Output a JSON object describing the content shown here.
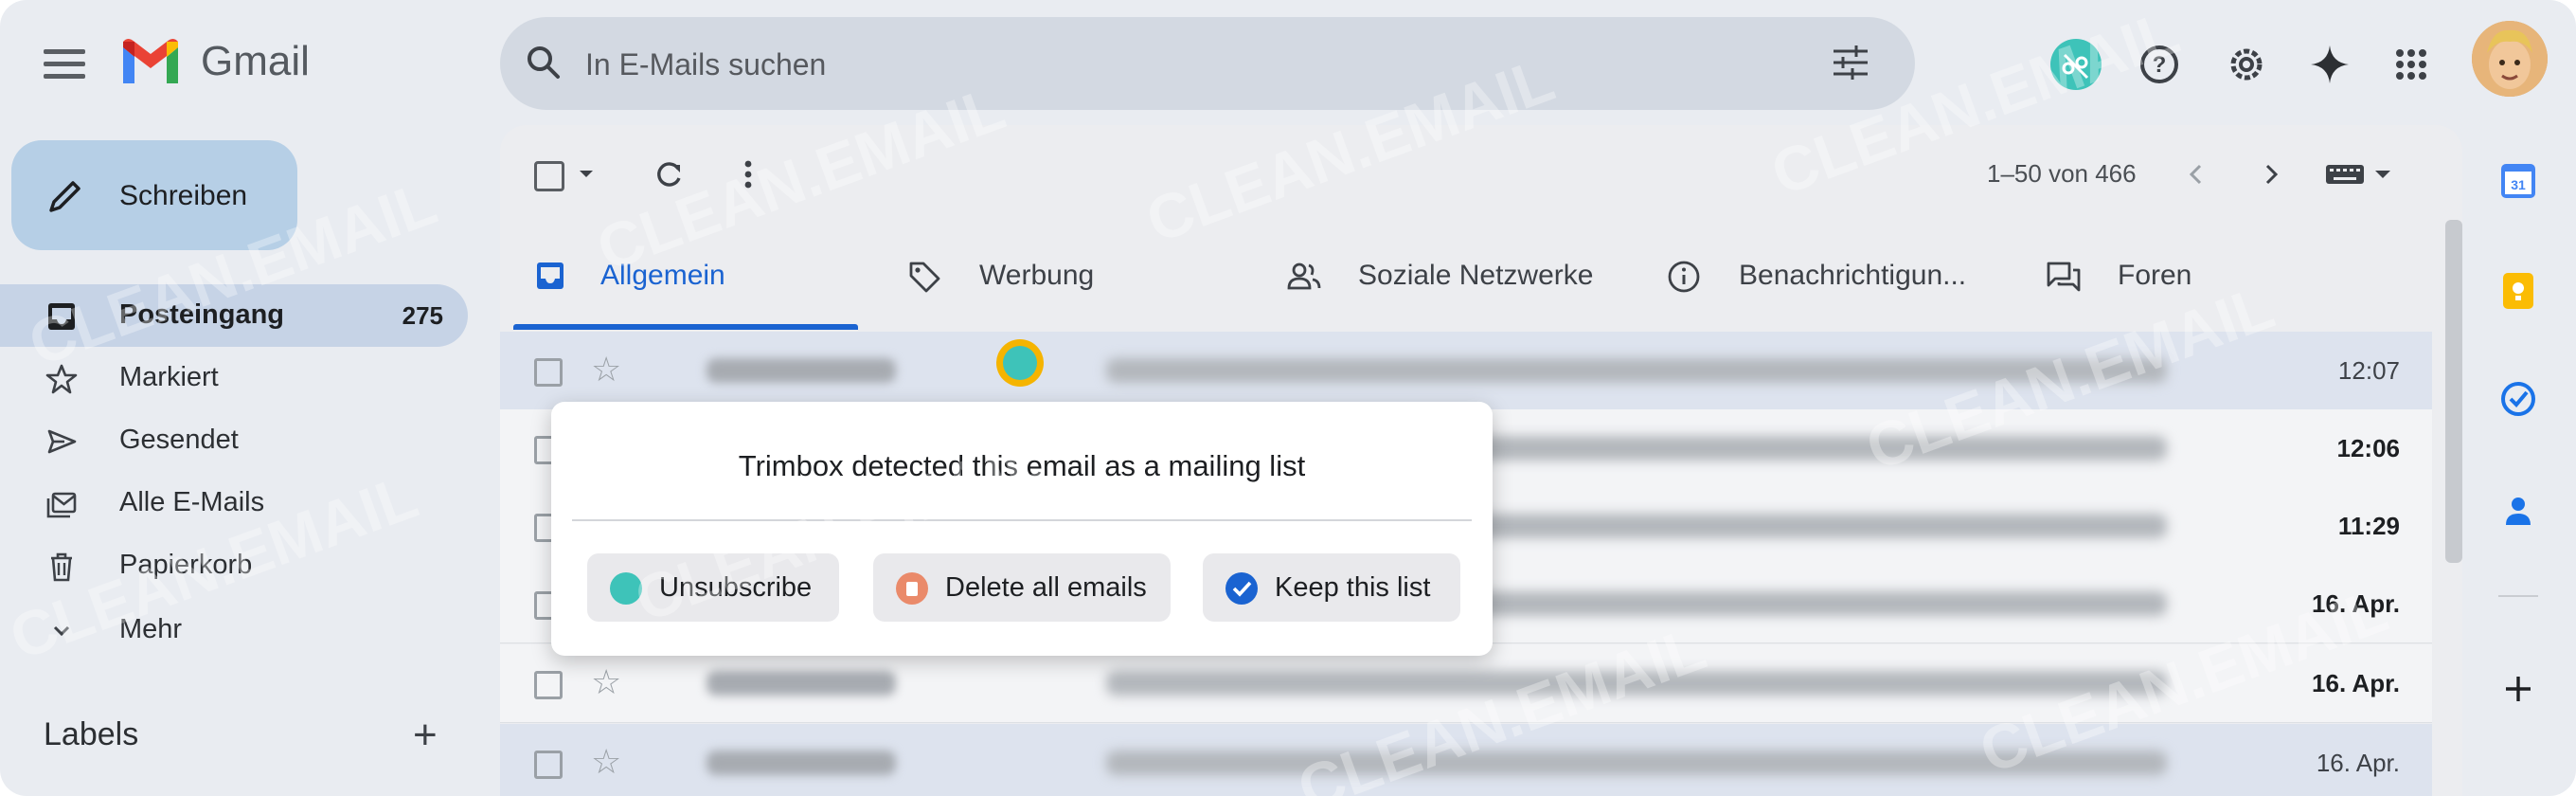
{
  "app": {
    "logo_text": "Gmail",
    "brand_colors": {
      "accent": "#1a63d1",
      "trimbox": "#3ec3b9",
      "trimbox_ring": "#f5b400"
    }
  },
  "search": {
    "placeholder": "In E-Mails suchen"
  },
  "compose": {
    "label": "Schreiben"
  },
  "nav": [
    {
      "label": "Posteingang",
      "count": "275",
      "icon": "inbox-icon",
      "active": true
    },
    {
      "label": "Markiert",
      "icon": "star-icon"
    },
    {
      "label": "Gesendet",
      "icon": "send-icon"
    },
    {
      "label": "Alle E-Mails",
      "icon": "all-mail-icon"
    },
    {
      "label": "Papierkorb",
      "icon": "trash-icon"
    },
    {
      "label": "Mehr",
      "icon": "chevron-down-icon"
    }
  ],
  "labels": {
    "heading": "Labels",
    "add_symbol": "+"
  },
  "toolbar": {
    "pagination": "1–50 von 466"
  },
  "tabs": [
    {
      "label": "Allgemein",
      "icon": "inbox-icon",
      "active": true
    },
    {
      "label": "Werbung",
      "icon": "tag-icon"
    },
    {
      "label": "Soziale Netzwerke",
      "icon": "people-icon"
    },
    {
      "label": "Benachrichtigun...",
      "icon": "info-icon"
    },
    {
      "label": "Foren",
      "icon": "forum-icon"
    }
  ],
  "emails": [
    {
      "time": "12:07",
      "bold": false
    },
    {
      "time": "12:06",
      "bold": true
    },
    {
      "time": "11:29",
      "bold": true
    },
    {
      "time": "16. Apr.",
      "bold": true
    },
    {
      "time": "16. Apr.",
      "bold": true
    },
    {
      "time": "16. Apr.",
      "bold": false
    }
  ],
  "trimbox_popup": {
    "message": "Trimbox detected this email as a mailing list",
    "buttons": [
      {
        "label": "Unsubscribe",
        "icon": "trimbox-icon"
      },
      {
        "label": "Delete all emails",
        "icon": "delete-icon"
      },
      {
        "label": "Keep this list",
        "icon": "check-icon"
      }
    ]
  },
  "watermark": "CLEAN.EMAIL"
}
